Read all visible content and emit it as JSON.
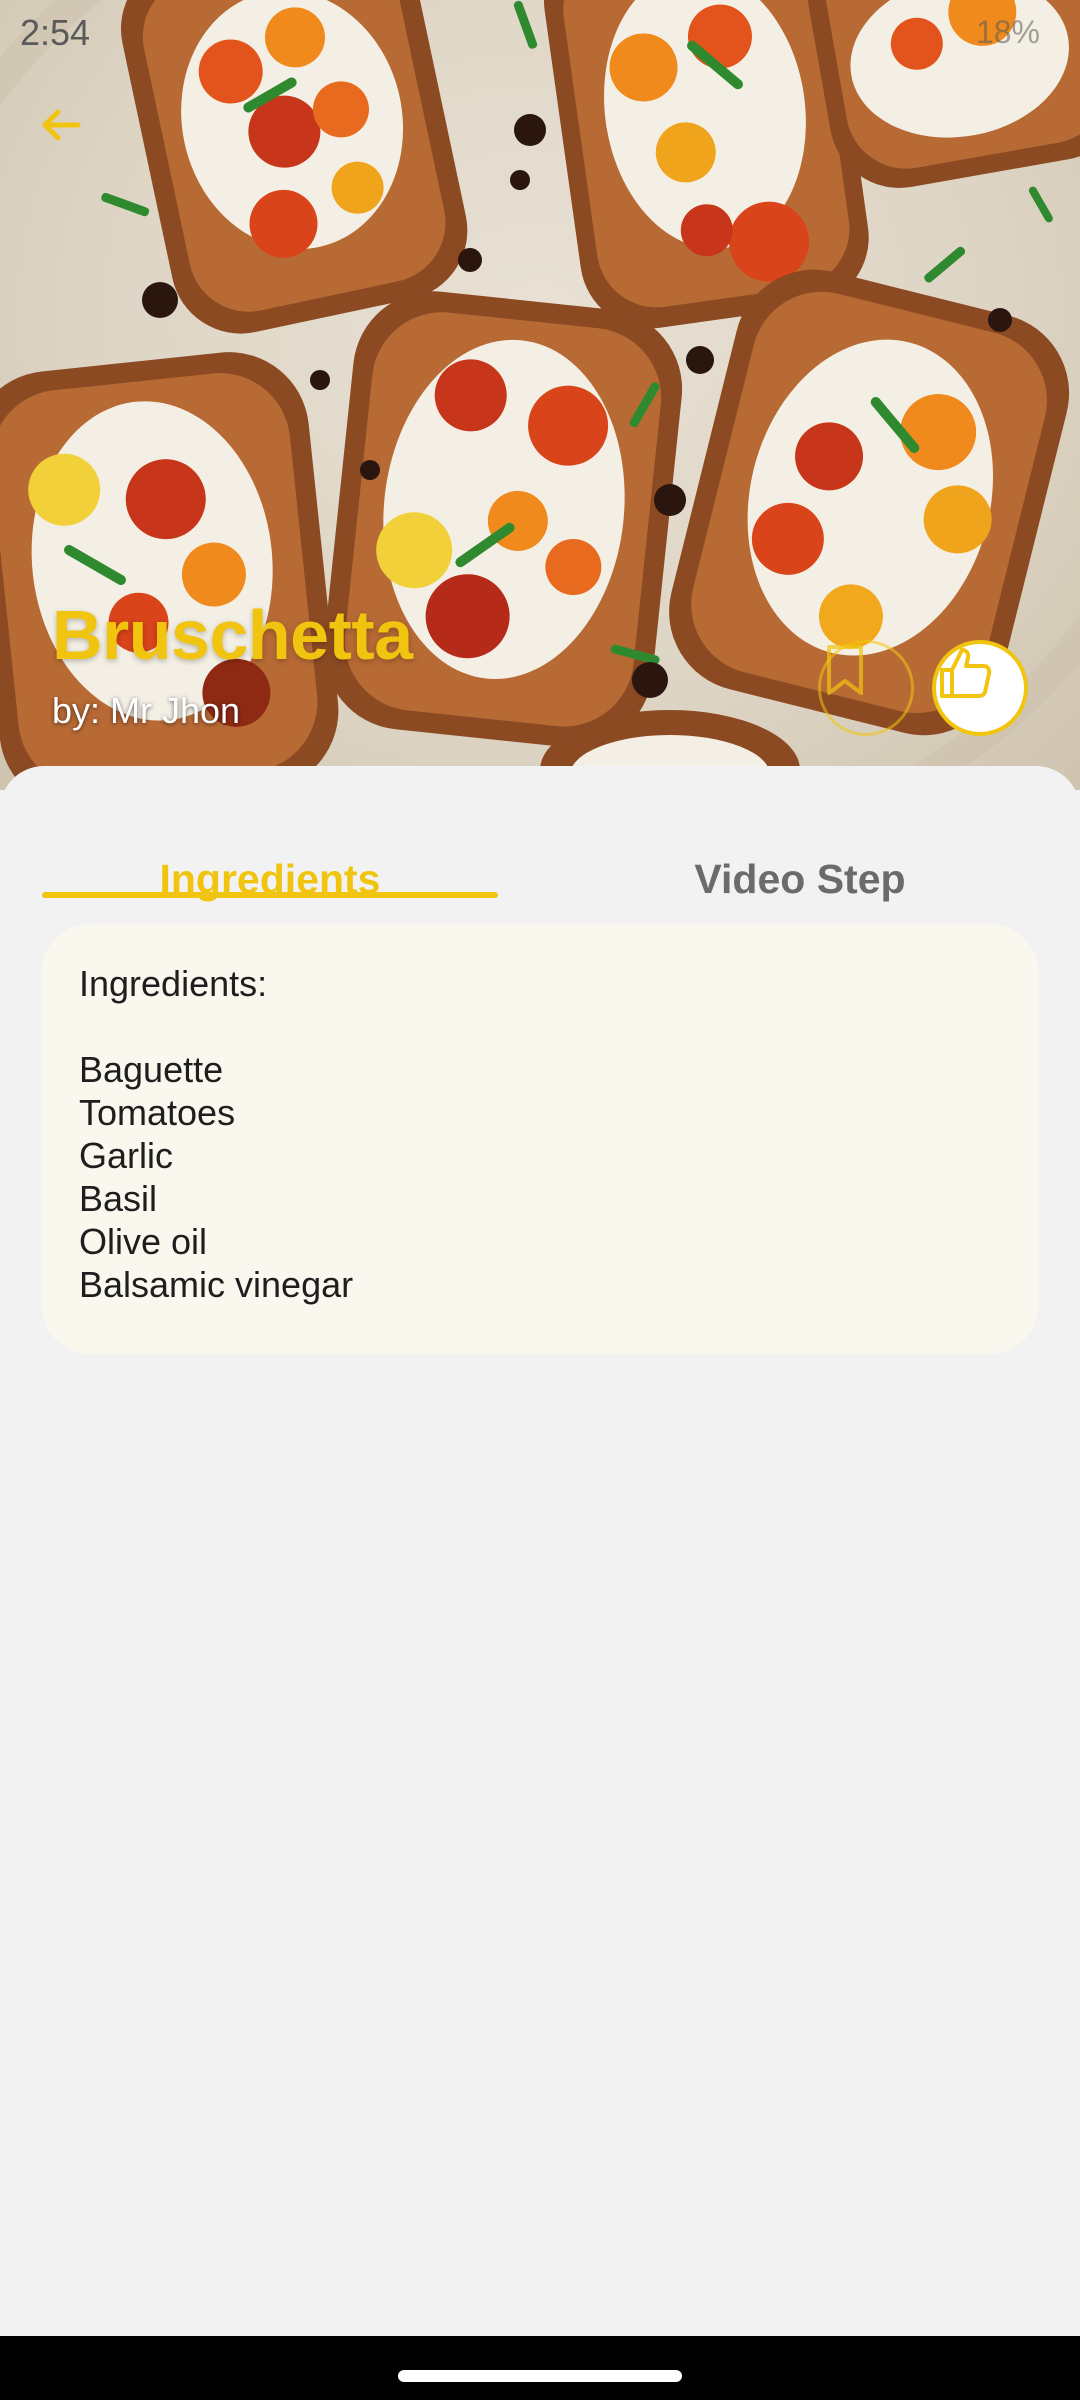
{
  "status_bar": {
    "time": "2:54",
    "right_text": "18%"
  },
  "recipe": {
    "title": "Bruschetta",
    "author": "by: Mr Jhon",
    "image_icon": "bruschetta-photo"
  },
  "header": {
    "back_icon": "arrow-left-icon",
    "bookmark_icon": "bookmark-icon",
    "like_icon": "thumbs-up-icon"
  },
  "tabs": [
    {
      "label": "Ingredients",
      "active": true
    },
    {
      "label": "Video Step",
      "active": false
    }
  ],
  "ingredients": {
    "heading": "Ingredients:",
    "items": [
      "Baguette",
      "Tomatoes",
      "Garlic",
      "Basil",
      "Olive oil",
      "Balsamic vinegar"
    ]
  },
  "colors": {
    "accent": "#f1c40f",
    "background": "#f2f2f2",
    "card": "#f9f7ee",
    "tab_inactive": "#6b6b6b"
  }
}
